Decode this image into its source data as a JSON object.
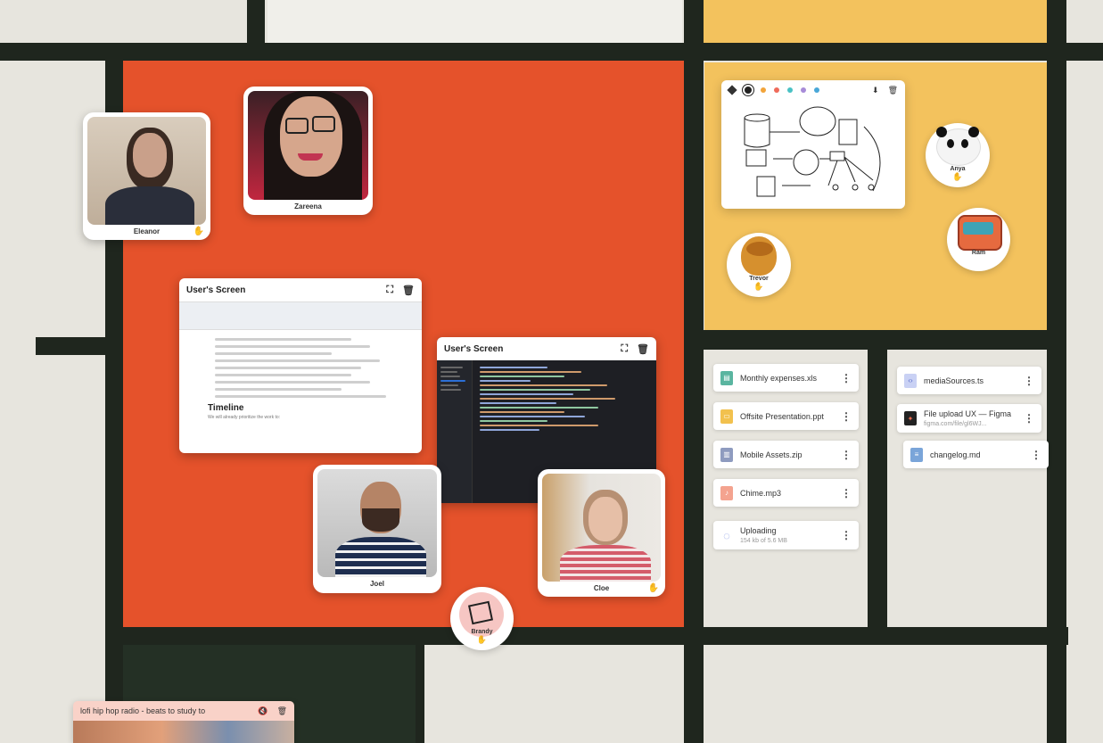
{
  "participants": {
    "eleanor": "Eleanor",
    "zareena": "Zareena",
    "joel": "Joel",
    "cloe": "Cloe",
    "anya": "Anya",
    "ram": "Ram",
    "trevor": "Trevor",
    "brandy": "Brandy"
  },
  "screens": {
    "doc_title": "User's Screen",
    "code_title": "User's Screen",
    "doc_heading": "Timeline",
    "doc_footer": "We will already prioritize the work to:"
  },
  "files_left": [
    {
      "name": "Monthly expenses.xls",
      "color": "#5ab5a0"
    },
    {
      "name": "Offsite Presentation.ppt",
      "color": "#f2c14e"
    },
    {
      "name": "Mobile Assets.zip",
      "color": "#8e9bbf"
    },
    {
      "name": "Chime.mp3",
      "color": "#f4a38f"
    },
    {
      "name": "Uploading",
      "sub": "154 kb of 5.6 MB",
      "color": "#8ea0e8"
    }
  ],
  "files_right": [
    {
      "name": "mediaSources.ts",
      "color": "#8ea0e8"
    },
    {
      "name": "File upload UX — Figma",
      "sub": "figma.com/file/gl6WJ...",
      "color": "#222222"
    },
    {
      "name": "changelog.md",
      "color": "#7aa5d9"
    }
  ],
  "music": {
    "title": "lofi hip hop radio - beats to study to"
  },
  "colors": {
    "red": "#e5522b",
    "yellow": "#f3c25d",
    "line": "#1f261e",
    "accent": "#e4523a"
  },
  "icons": {
    "hand": "✋",
    "expand": "⛶",
    "trash": "🗑",
    "dots": "⋮",
    "mute": "🔇",
    "download": "⬇"
  }
}
